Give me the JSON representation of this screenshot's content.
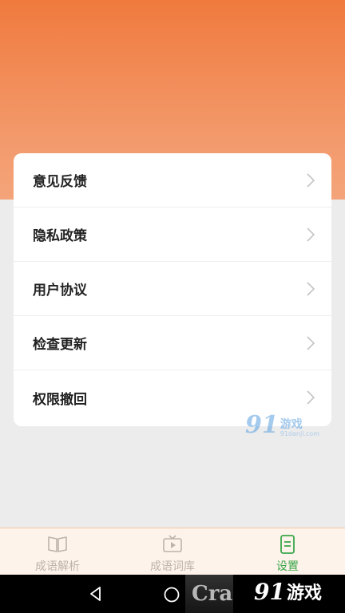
{
  "menu": {
    "items": [
      {
        "label": "意见反馈"
      },
      {
        "label": "隐私政策"
      },
      {
        "label": "用户协议"
      },
      {
        "label": "检查更新"
      },
      {
        "label": "权限撤回"
      }
    ]
  },
  "watermark": {
    "num": "91",
    "cn": "游戏",
    "url": "91danji.com"
  },
  "bottom_nav": {
    "tabs": [
      {
        "label": "成语解析",
        "icon": "book-icon",
        "active": false
      },
      {
        "label": "成语词库",
        "icon": "tv-play-icon",
        "active": false
      },
      {
        "label": "设置",
        "icon": "document-icon",
        "active": true
      }
    ]
  },
  "system_bar": {
    "watermark_num": "91",
    "watermark_cn": "游戏",
    "overlay_logo": "Cra"
  },
  "colors": {
    "accent_orange": "#f07a3e",
    "active_green": "#3aa64a",
    "inactive": "#bdb3ab"
  }
}
